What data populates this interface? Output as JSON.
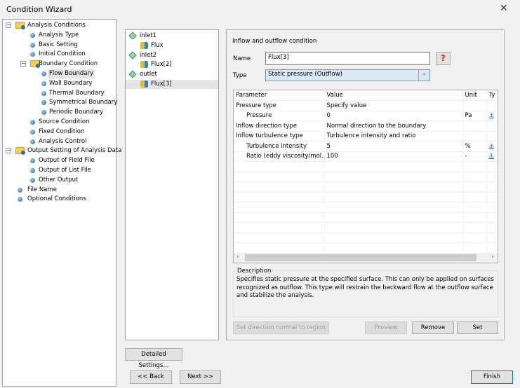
{
  "window": {
    "title": "Condition Wizard",
    "close": "✕"
  },
  "tree": [
    {
      "label": "Analysis Conditions",
      "level": 0,
      "kind": "folder",
      "expander": "−"
    },
    {
      "label": "Analysis Type",
      "level": 1
    },
    {
      "label": "Basic Setting",
      "level": 1
    },
    {
      "label": "Initial Condition",
      "level": 1
    },
    {
      "label": "Boundary Condition",
      "level": 1,
      "kind": "folder",
      "expander": "−"
    },
    {
      "label": "Flow Boundary",
      "level": 2,
      "selected": true
    },
    {
      "label": "Wall Boundary",
      "level": 2
    },
    {
      "label": "Thermal Boundary",
      "level": 2
    },
    {
      "label": "Symmetrical Boundary",
      "level": 2
    },
    {
      "label": "Periodic Boundary",
      "level": 2
    },
    {
      "label": "Source Condition",
      "level": 1
    },
    {
      "label": "Fixed Condition",
      "level": 1
    },
    {
      "label": "Analysis Control",
      "level": 1
    },
    {
      "label": "Output Setting of Analysis Data",
      "level": 0,
      "kind": "folder",
      "expander": "−"
    },
    {
      "label": "Output of Field File",
      "level": 1
    },
    {
      "label": "Output of List File",
      "level": 1
    },
    {
      "label": "Other Output",
      "level": 1
    },
    {
      "label": "File Name",
      "level": 0
    },
    {
      "label": "Optional Conditions",
      "level": 0
    }
  ],
  "boundaries": [
    {
      "label": "inlet1",
      "kind": "region"
    },
    {
      "label": "Flux",
      "kind": "condition"
    },
    {
      "label": "inlet2",
      "kind": "region"
    },
    {
      "label": "Flux[2]",
      "kind": "condition"
    },
    {
      "label": "outlet",
      "kind": "region"
    },
    {
      "label": "Flux[3]",
      "kind": "condition",
      "selected": true
    }
  ],
  "form": {
    "group_title": "Inflow and outflow condition",
    "name_label": "Name",
    "name_value": "Flux[3]",
    "help_icon": "?",
    "type_label": "Type",
    "type_value": "Static pressure (Outflow)"
  },
  "table": {
    "headers": [
      "Parameter",
      "Value",
      "Unit",
      "Ty"
    ],
    "rows": [
      {
        "param": "Pressure type",
        "value": "Specify value",
        "unit": "",
        "indent": false,
        "anchor": false
      },
      {
        "param": "Pressure",
        "value": "0",
        "unit": "Pa",
        "indent": true,
        "anchor": true
      },
      {
        "param": "Inflow direction type",
        "value": "Normal direction to the boundary",
        "unit": "",
        "indent": false,
        "anchor": false
      },
      {
        "param": "Inflow turbulence type",
        "value": "Turbulence intensity and ratio",
        "unit": "",
        "indent": false,
        "anchor": false
      },
      {
        "param": "Turbulence intensity",
        "value": "5",
        "unit": "%",
        "indent": true,
        "anchor": true
      },
      {
        "param": "Ratio (eddy viscosity/mol...",
        "value": "100",
        "unit": "-",
        "indent": true,
        "anchor": true
      }
    ],
    "anchor_glyph": "⚓"
  },
  "description": {
    "title": "Description",
    "text": "Specifies static pressure at the specified surface. This can only be applied on surfaces recognized as outflow. This type will restrain the backward flow at the outflow surface and stabilize the analysis."
  },
  "buttons": {
    "set_direction": "Set direction normal to region",
    "preview": "Preview",
    "remove": "Remove",
    "set": "Set",
    "detailed": "Detailed Settings...",
    "back": "<< Back",
    "next": "Next >>",
    "finish": "Finish"
  }
}
